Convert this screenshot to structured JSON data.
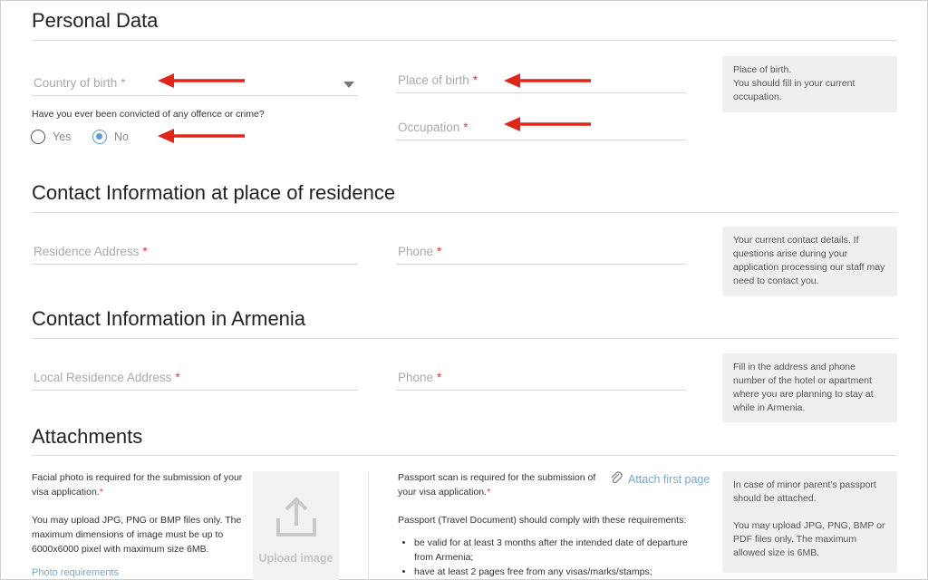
{
  "colors": {
    "accent": "#5b9bd5",
    "required": "#e53935",
    "annotation_arrow": "#e0251b"
  },
  "personal": {
    "title": "Personal Data",
    "country_of_birth": {
      "placeholder": "Country of birth",
      "required": "*"
    },
    "place_of_birth": {
      "placeholder": "Place of birth",
      "required": "*"
    },
    "occupation": {
      "placeholder": "Occupation",
      "required": "*"
    },
    "conviction_question": "Have you ever been convicted of any offence or crime?",
    "radio_yes": "Yes",
    "radio_no": "No",
    "selected": "No",
    "hint": [
      "Place of birth.",
      "You should fill in your current occupation."
    ]
  },
  "residence": {
    "title": "Contact Information at place of residence",
    "address": {
      "placeholder": "Residence Address",
      "required": "*"
    },
    "phone": {
      "placeholder": "Phone",
      "required": "*"
    },
    "hint": "Your current contact details. If questions arise during your application processing our staff may need to contact you."
  },
  "armenia": {
    "title": "Contact Information in Armenia",
    "address": {
      "placeholder": "Local Residence Address",
      "required": "*"
    },
    "phone": {
      "placeholder": "Phone",
      "required": "*"
    },
    "hint": "Fill in the address and phone number of the hotel or apartment where you are planning to stay at while in Armenia."
  },
  "attachments": {
    "title": "Attachments",
    "photo_text": "Facial photo is required for the submission of your visa application.",
    "photo_required": "*",
    "photo_formats": "You may upload JPG, PNG or BMP files only. The maximum dimensions of image must be up to 6000x6000 pixel with maximum size 6MB.",
    "photo_link": "Photo requirements",
    "upload_label": "Upload image",
    "passport_text": "Passport scan is required for the submission of your visa application.",
    "passport_required": "*",
    "attach_link": "Attach first page",
    "passport_reqs_intro": "Passport (Travel Document) should comply with these requirements:",
    "passport_reqs": [
      "be valid for at least 3 months after the intended date of departure from Armenia;",
      "have at least 2 pages free from any visas/marks/stamps;"
    ],
    "hint_1": "In case of minor parent's passport should be attached.",
    "hint_2": "You may upload JPG, PNG, BMP or PDF files only. The maximum allowed size is 6MB."
  }
}
